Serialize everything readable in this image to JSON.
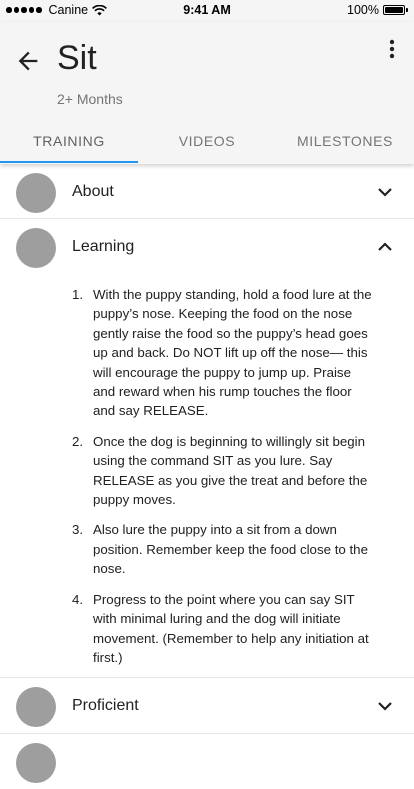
{
  "status_bar": {
    "carrier": "Canine",
    "time": "9:41 AM",
    "battery": "100%"
  },
  "header": {
    "title": "Sit",
    "subtitle": "2+ Months",
    "tabs": [
      {
        "label": "TRAINING",
        "active": true
      },
      {
        "label": "VIDEOS",
        "active": false
      },
      {
        "label": "MILESTONES",
        "active": false
      }
    ],
    "accent_color": "#2196f3"
  },
  "sections": [
    {
      "label": "About",
      "expanded": false,
      "chevron": "chevron-down-icon"
    },
    {
      "label": "Learning",
      "expanded": true,
      "chevron": "chevron-up-icon",
      "steps": [
        {
          "num": "1.",
          "text": "With the puppy standing, hold a food lure at the puppy’s nose. Keeping the food on the nose gently raise the food so the puppy’s head goes up and back. Do NOT lift up off the nose— this will encourage the puppy to jump up. Praise and reward when his rump touches the floor and say RELEASE."
        },
        {
          "num": "2.",
          "text": "Once the dog is beginning to willingly sit begin using the command SIT as you lure. Say RELEASE as you give the treat and before the puppy moves."
        },
        {
          "num": "3.",
          "text": "Also lure the puppy into a sit from a down position. Remember keep the food close to the nose."
        },
        {
          "num": "4.",
          "text": "Progress to the point where you can say SIT with minimal luring and the dog will initiate movement. (Remember to help any initiation at first.)"
        }
      ]
    },
    {
      "label": "Proficient",
      "expanded": false,
      "chevron": "chevron-down-icon"
    }
  ]
}
